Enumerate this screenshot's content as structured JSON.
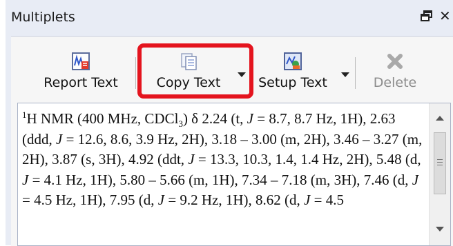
{
  "window": {
    "title": "Multiplets",
    "float_icon": "float-window-icon",
    "close_symbol": "✕"
  },
  "toolbar": {
    "report_text": {
      "label": "Report Text",
      "icon": "report-text-icon"
    },
    "copy_text": {
      "label": "Copy Text",
      "icon": "copy-text-icon"
    },
    "setup_text": {
      "label": "Setup Text",
      "icon": "setup-text-icon"
    },
    "delete": {
      "label": "Delete",
      "icon": "delete-icon",
      "enabled": false
    }
  },
  "annotation": {
    "highlight_color": "#e4141e"
  },
  "report": {
    "nucleus_mass": "1",
    "nucleus_symbol": "H",
    "lead": " NMR (400 MHz, CDCl",
    "solvent_subscript": "3",
    "lead_tail": ") δ 2.24 (t, ",
    "s1": " = 8.7, 8.7 Hz, 1H), 2.63 (ddd, ",
    "s2": " = 12.6, 8.6, 3.9 Hz, 2H), 3.18 – 3.00 (m, 2H), 3.46 – 3.27 (m, 2H), 3.87 (s, 3H), 4.92 (ddt, ",
    "s3": " = 13.3, 10.3, 1.4, 1.4 Hz, 2H), 5.48 (d, ",
    "s4": " = 4.1 Hz, 1H), 5.80 – 5.66 (m, 1H), 7.34 – 7.18 (m, 3H), 7.46 (d, ",
    "s5": " = 4.5 Hz, 1H), 7.95 (d, ",
    "s6": " = 9.2 Hz, 1H), 8.62 (d, ",
    "s7": " = 4.5",
    "j_symbol": "J"
  },
  "colors": {
    "panel_bg": "#e8ecf5",
    "toolbar_bg": "#f6f6f6",
    "text_bg": "#ffffff"
  }
}
